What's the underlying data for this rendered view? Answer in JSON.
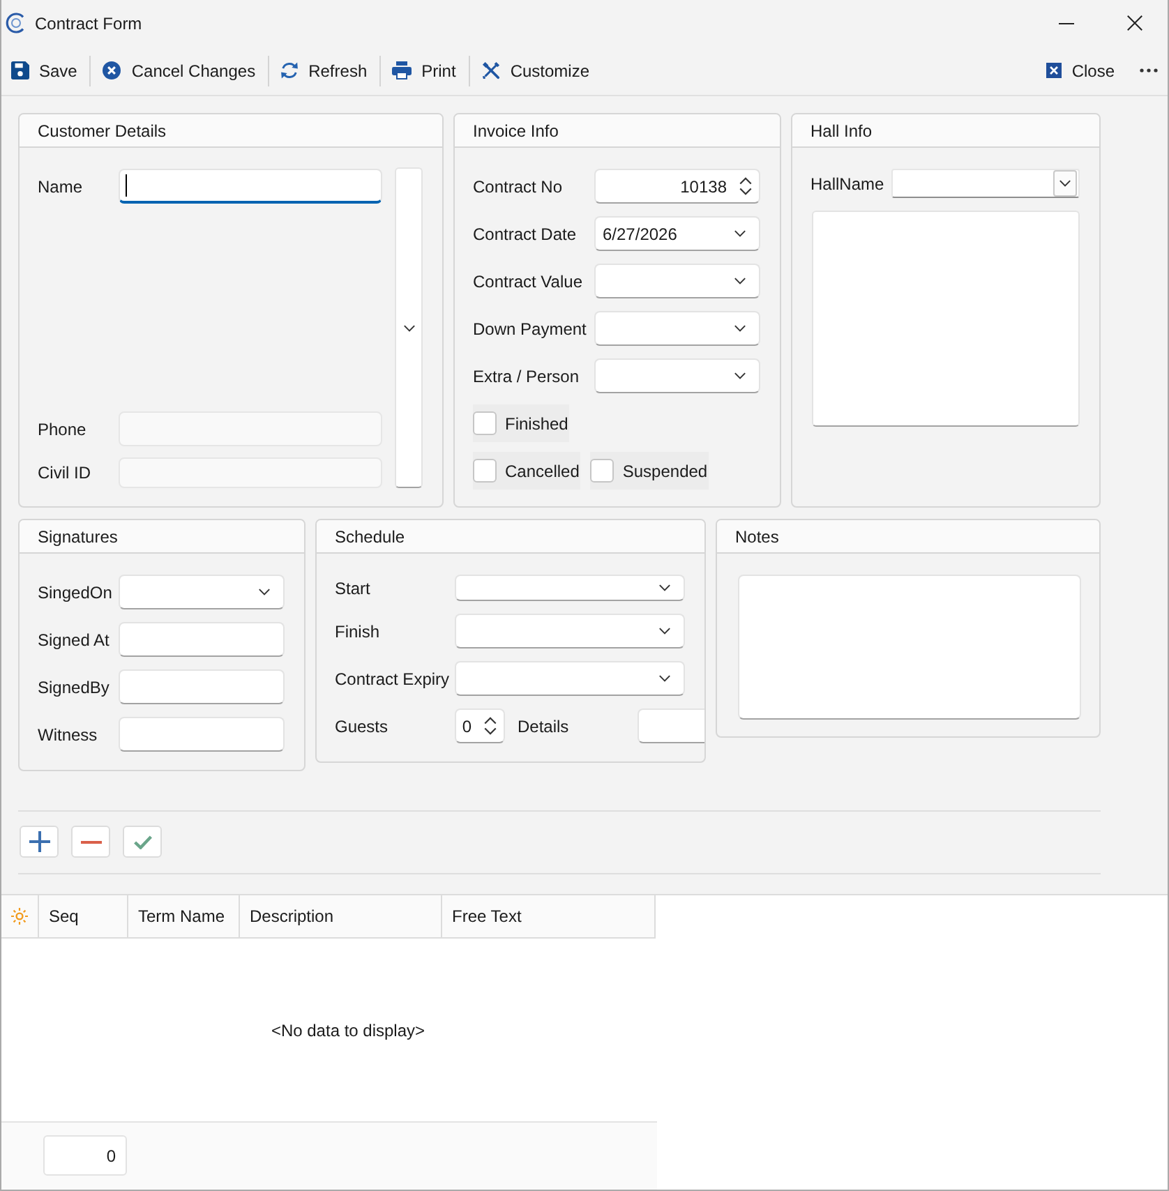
{
  "window": {
    "title": "Contract Form"
  },
  "toolbar": {
    "items": [
      {
        "kind": "save",
        "label": "Save"
      },
      {
        "kind": "cancel",
        "label": "Cancel Changes"
      },
      {
        "kind": "refresh",
        "label": "Refresh"
      },
      {
        "kind": "print",
        "label": "Print"
      },
      {
        "kind": "customize",
        "label": "Customize"
      }
    ],
    "right_items": [
      {
        "kind": "close",
        "label": "Close"
      }
    ]
  },
  "customer_details": {
    "title": "Customer Details",
    "fields": [
      {
        "label": "Name",
        "focused": true,
        "disabled": false
      },
      {
        "label": "Phone",
        "focused": false,
        "disabled": true
      },
      {
        "label": "Civil ID",
        "focused": false,
        "disabled": true
      }
    ]
  },
  "invoice_info": {
    "title": "Invoice Info",
    "fields": [
      {
        "label": "Contract No",
        "kind": "spin",
        "value": "10138"
      },
      {
        "label": "Contract Date",
        "kind": "dropdown",
        "value": "6/27/2026"
      },
      {
        "label": "Contract Value",
        "kind": "dropdown"
      },
      {
        "label": "Down Payment",
        "kind": "dropdown"
      },
      {
        "label": "Extra / Person",
        "kind": "dropdown"
      }
    ],
    "checkbox_rows": [
      {
        "items": [
          {
            "label": "Finished",
            "checked": false
          }
        ]
      },
      {
        "items": [
          {
            "label": "Cancelled",
            "checked": false
          },
          {
            "label": "Suspended",
            "checked": false
          }
        ]
      }
    ]
  },
  "hall_info": {
    "title": "Hall Info",
    "field": {
      "label": "HallName"
    }
  },
  "signatures": {
    "title": "Signatures",
    "fields": [
      {
        "label": "SingedOn",
        "kind": "dropdown"
      },
      {
        "label": "Signed At",
        "kind": "text"
      },
      {
        "label": "SignedBy",
        "kind": "text"
      },
      {
        "label": "Witness",
        "kind": "text"
      }
    ]
  },
  "schedule": {
    "title": "Schedule",
    "fields": [
      {
        "label": "Start",
        "kind": "dropdown"
      },
      {
        "label": "Finish",
        "kind": "dropdown"
      },
      {
        "label": "Contract Expiry",
        "kind": "dropdown"
      }
    ],
    "guests": {
      "label": "Guests",
      "value": "0"
    },
    "details": {
      "label": "Details"
    }
  },
  "notes": {
    "title": "Notes"
  },
  "row_actions": [
    {
      "kind": "add"
    },
    {
      "kind": "remove"
    },
    {
      "kind": "confirm"
    }
  ],
  "grid": {
    "columns": [
      "Seq",
      "Term Name",
      "Description",
      "Free Text"
    ],
    "empty_text": "<No data to display>",
    "footer_total": "0"
  }
}
